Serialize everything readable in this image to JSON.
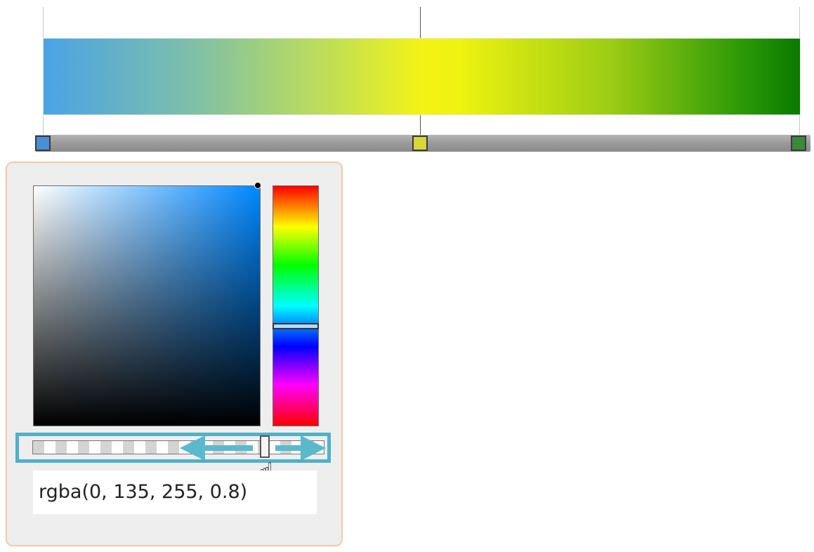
{
  "gradient": {
    "stops": [
      {
        "name": "stop-left",
        "color": "#4a8ed6"
      },
      {
        "name": "stop-middle",
        "color": "#d8d63a"
      },
      {
        "name": "stop-right",
        "color": "#3a8a3a"
      }
    ]
  },
  "picker": {
    "hue_color": "#0087ff",
    "value_text": "rgba(0, 135, 255, 0.8)",
    "alpha": 0.8,
    "highlight_color": "#4fb2c7"
  },
  "icons": {
    "cursor": "pointing-hand-icon",
    "arrow_left": "arrow-left-icon",
    "arrow_right": "arrow-right-icon"
  }
}
